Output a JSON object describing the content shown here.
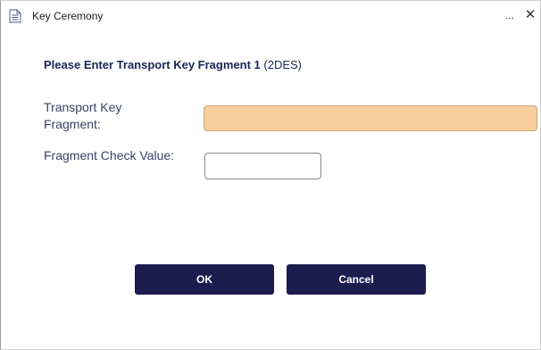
{
  "window": {
    "title": "Key Ceremony",
    "more_label": "...",
    "close_label": "✕"
  },
  "dialog": {
    "heading_bold": "Please Enter Transport Key Fragment 1",
    "heading_suffix": "(2DES)",
    "fields": [
      {
        "label": "Transport Key Fragment:",
        "value": "",
        "placeholder": ""
      },
      {
        "label": "Fragment Check Value:",
        "value": "",
        "placeholder": ""
      }
    ],
    "buttons": {
      "ok": "OK",
      "cancel": "Cancel"
    }
  },
  "colors": {
    "accent_button": "#1b1d4f",
    "highlighted_input": "#f8cf9c",
    "label_text": "#3a3f66"
  }
}
